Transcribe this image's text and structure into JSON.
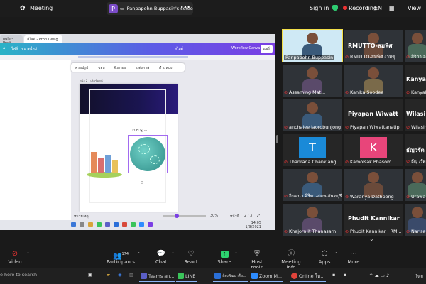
{
  "topbar": {
    "meeting_label": "Meeting",
    "share_badge": "P",
    "share_text": "Panpapohn Buppasin's scree",
    "share_more": "•••",
    "signin": "Sign in",
    "recording": "Recording",
    "lang": "EN",
    "view": "View"
  },
  "shared_screen": {
    "tabs": [
      "ngle - Profi",
      "สไลด์ - Profi Desig"
    ],
    "toolbar": [
      "ไฟล์",
      "ขนาดใหม่",
      "สไลด์",
      "Workflow Canva",
      "แชร์"
    ],
    "context_toolbar": [
      "ครอปรูป",
      "ขอบ",
      "ตัวกรอง",
      "แต่งภาพ",
      "ตำแหน่ง"
    ],
    "page_label": "หน้า 2 - เพิ่มชื่อหน้า",
    "footer": {
      "notes": "หมายเหตุ",
      "zoom": "30%",
      "pages": "หน้าที่",
      "page_count": "2 / 3"
    },
    "clock": {
      "time": "14:05",
      "date": "1/9/2021"
    }
  },
  "gallery": {
    "tiles": [
      {
        "name": "Panpapohn Buppasin",
        "type": "video",
        "muted": false,
        "active": true
      },
      {
        "name": "RMUTTO-สมพิศ งามขุ...",
        "big": "RMUTTO-สมพิศ",
        "type": "video",
        "muted": true
      },
      {
        "name": "สิริกา อ",
        "type": "video",
        "muted": true
      },
      {
        "name": "Assaming Mat...",
        "type": "video",
        "muted": true
      },
      {
        "name": "Kanika Soodee",
        "type": "video",
        "muted": true
      },
      {
        "name": "Kanyak",
        "big": "Kanyak",
        "type": "name",
        "muted": true
      },
      {
        "name": "anchalee laorobunjong",
        "type": "video",
        "muted": true
      },
      {
        "name": "Piyapan Wiwattanatip",
        "big": "Piyapan Wiwatt",
        "type": "name",
        "muted": true
      },
      {
        "name": "Wilasini",
        "big": "Wilasi",
        "type": "name",
        "muted": true
      },
      {
        "name": "Thanrada Chanklang",
        "letter": "T",
        "type": "letter",
        "muted": true
      },
      {
        "name": "Kamolsak Phasom",
        "letter": "K",
        "type": "letter",
        "muted": true
      },
      {
        "name": "ธัญวรัตน์",
        "big": "ธัญวรัต",
        "type": "name",
        "muted": true
      },
      {
        "name": "จินตนา ศิริพา-สมพ-จันทบุรี",
        "type": "video",
        "muted": true
      },
      {
        "name": "Waranya Dathpong",
        "type": "video",
        "muted": true
      },
      {
        "name": "Urawa",
        "type": "video",
        "muted": true
      },
      {
        "name": "Khajornjit Thanasarn",
        "type": "video",
        "muted": true
      },
      {
        "name": "Phudit Kannikar : RM...",
        "big": "Phudit Kannikar",
        "type": "name",
        "muted": true
      },
      {
        "name": "Narisa",
        "type": "video",
        "muted": true
      }
    ],
    "chevron": "⌄"
  },
  "controls": {
    "video": "Video",
    "participants": "Participants",
    "participant_count": "174",
    "chat": "Chat",
    "react": "React",
    "share": "Share",
    "host_tools": "Host tools",
    "meeting_info": "Meeting info",
    "apps": "Apps",
    "more": "More"
  },
  "os_taskbar": {
    "search": "e here to search",
    "apps": [
      "Teams an...",
      "LINE",
      "ห้องพัฒนาสื่อ...",
      "Zoom M...",
      "Online โท..."
    ],
    "tray": "ไทย"
  }
}
